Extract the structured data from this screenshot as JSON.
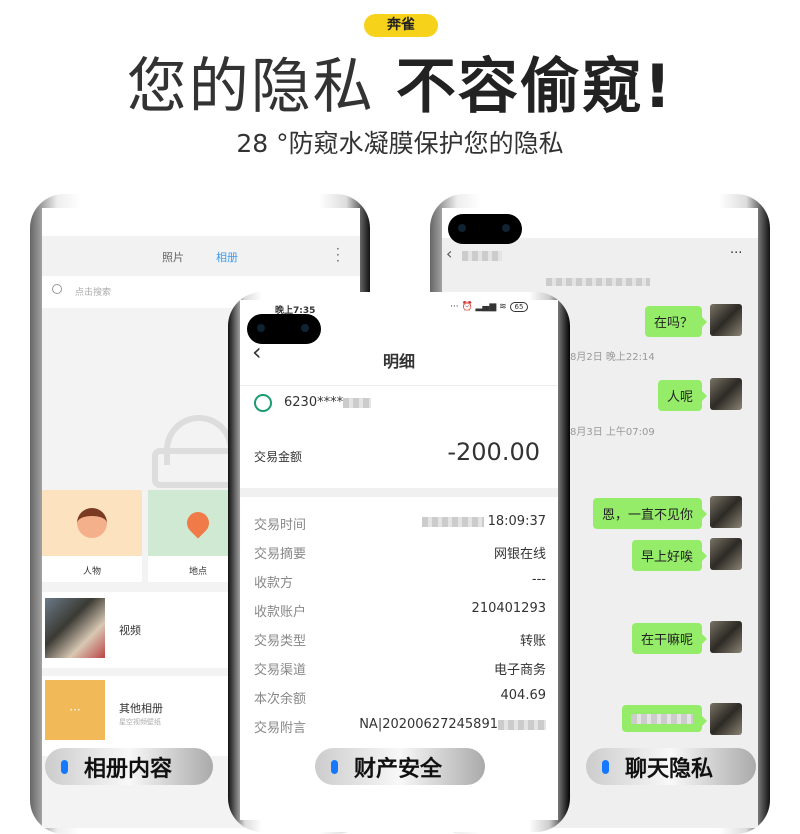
{
  "brand": "奔雀",
  "headline": {
    "part1": "您的隐私",
    "part2": "不容偷窥!"
  },
  "subtitle": "28 °防窥水凝膜保护您的隐私",
  "gallery": {
    "tabs": [
      "照片",
      "相册"
    ],
    "active_tab": "相册",
    "search_placeholder": "点击搜索",
    "tiles": [
      {
        "label": "人物"
      },
      {
        "label": "地点"
      }
    ],
    "albums": [
      {
        "title": "视频"
      },
      {
        "title": "其他相册",
        "subtitle": "星空视频壁纸"
      }
    ],
    "caption": "相册内容"
  },
  "bank": {
    "status_time": "晚上7:35",
    "battery": "65",
    "title": "明细",
    "card": "6230****",
    "amount_label": "交易金额",
    "amount": "-200.00",
    "rows": [
      {
        "k": "交易时间",
        "v": "18:09:37"
      },
      {
        "k": "交易摘要",
        "v": "网银在线"
      },
      {
        "k": "收款方",
        "v": "---"
      },
      {
        "k": "收款账户",
        "v": "210401293"
      },
      {
        "k": "交易类型",
        "v": "转账"
      },
      {
        "k": "交易渠道",
        "v": "电子商务"
      },
      {
        "k": "本次余额",
        "v": "404.69"
      },
      {
        "k": "交易附言",
        "v": "NA|20200627245891"
      }
    ],
    "caption": "财产安全"
  },
  "chat": {
    "more": "···",
    "timestamps": [
      "8月2日 晚上22:14",
      "8月3日 上午07:09"
    ],
    "messages": [
      "在吗？",
      "人呢",
      "恩，一直不见你",
      "早上好唉",
      "在干嘛呢"
    ],
    "caption": "聊天隐私"
  },
  "colors": {
    "accent": "#f7d21a",
    "bubble": "#95ec69",
    "tab_active": "#3a9bf0",
    "pill_dot": "#1677ff"
  }
}
